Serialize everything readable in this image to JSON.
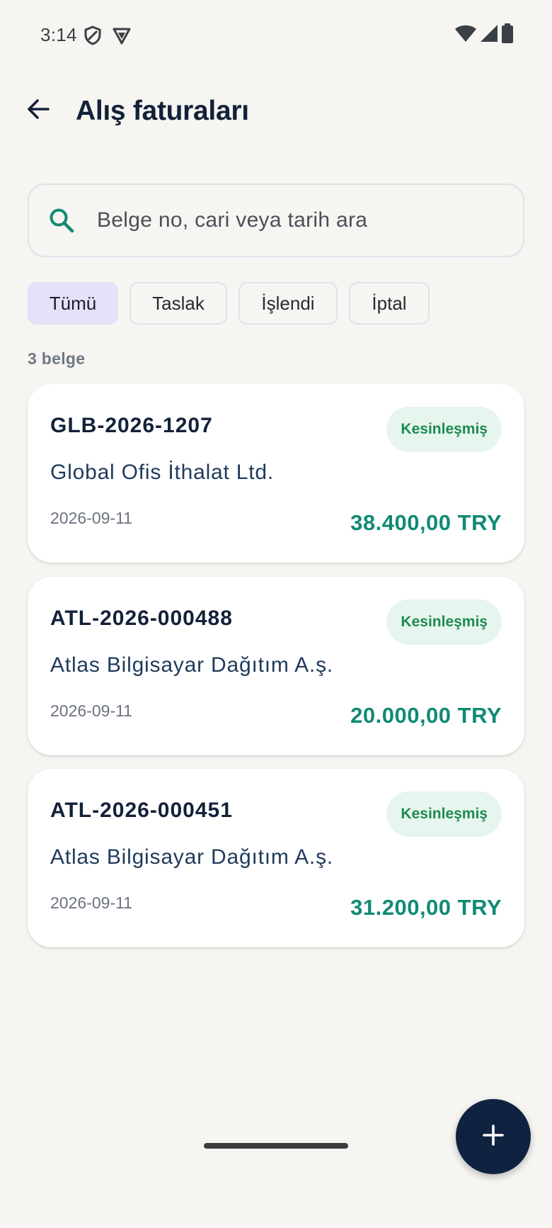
{
  "status_bar": {
    "time": "3:14"
  },
  "app_bar": {
    "title": "Alış faturaları"
  },
  "search": {
    "placeholder": "Belge no, cari veya tarih ara"
  },
  "filters": [
    {
      "label": "Tümü",
      "selected": true
    },
    {
      "label": "Taslak",
      "selected": false
    },
    {
      "label": "İşlendi",
      "selected": false
    },
    {
      "label": "İptal",
      "selected": false
    }
  ],
  "list": {
    "count_label": "3 belge",
    "items": [
      {
        "doc_no": "GLB-2026-1207",
        "party": "Global Ofis İthalat Ltd.",
        "date": "2026-09-11",
        "amount": "38.400,00 TRY",
        "status": "Kesinleşmiş"
      },
      {
        "doc_no": "ATL-2026-000488",
        "party": "Atlas Bilgisayar Dağıtım A.ş.",
        "date": "2026-09-11",
        "amount": "20.000,00 TRY",
        "status": "Kesinleşmiş"
      },
      {
        "doc_no": "ATL-2026-000451",
        "party": "Atlas Bilgisayar Dağıtım A.ş.",
        "date": "2026-09-11",
        "amount": "31.200,00 TRY",
        "status": "Kesinleşmiş"
      }
    ]
  },
  "colors": {
    "accent_teal": "#118a74",
    "fab_bg": "#0f2340",
    "chip_selected_bg": "#e6e0f8",
    "badge_bg": "#e6f5ed",
    "badge_text": "#1d8a55"
  },
  "icons": {
    "back": "arrow-left-icon",
    "search": "search-icon",
    "fab": "plus-icon"
  }
}
